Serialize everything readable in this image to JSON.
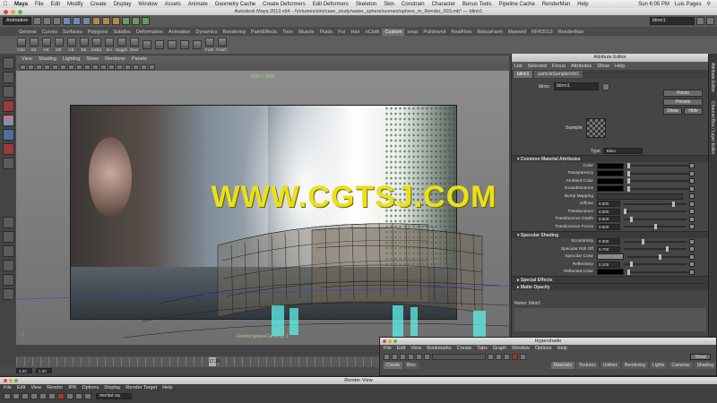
{
  "macmenu": {
    "app": "Maya",
    "items": [
      "File",
      "Edit",
      "Modify",
      "Create",
      "Display",
      "Window",
      "Assets",
      "Animate",
      "Geometry Cache",
      "Create Deformers",
      "Edit Deformers",
      "Skeleton",
      "Skin",
      "Constrain",
      "Character",
      "Bonus Tools",
      "Pipeline Cache",
      "RenderMan",
      "Help"
    ],
    "clock": "Sun 6:05 PM",
    "user": "Luis Pages"
  },
  "window": {
    "title": "Autodesk Maya 2013 x64 - /Volumes/sim/case_study/water_sphere/scenes/sphere_m_Render_003.mb* --- blinn1"
  },
  "statusline": {
    "mode": "Animation",
    "field": "blinn1"
  },
  "shelf": {
    "tabs": [
      "General",
      "Curves",
      "Surfaces",
      "Polygons",
      "Subdivs",
      "Deformation",
      "Animation",
      "Dynamics",
      "Rendering",
      "PaintEffects",
      "Toon",
      "Muscle",
      "Fluids",
      "Fur",
      "Hair",
      "nCloth",
      "Custom",
      "soup",
      "Pulldownit",
      "RealFlow",
      "RebusFarm",
      "Maxwell",
      "RFR2013",
      "RenderMan"
    ],
    "active_tab": "Custom",
    "icons": [
      "OutI",
      "SS",
      "HS",
      "DR",
      "CE",
      "EE",
      "bishd",
      "SH",
      "Hpgph",
      "Dext",
      "",
      "",
      "",
      "",
      "",
      "FLW",
      "FLWC"
    ]
  },
  "viewport": {
    "menu": [
      "View",
      "Shading",
      "Lighting",
      "Show",
      "Renderer",
      "Panels"
    ],
    "resolution": "1920 x 1080",
    "camera": "RenderSphereCamera1 1",
    "watermark": "WWW.CGTSJ.COM"
  },
  "timeslider": {
    "current_frame": "17.20",
    "start": "1.00",
    "end": "1.00"
  },
  "attribute_editor": {
    "title": "Attribute Editor",
    "menu": [
      "List",
      "Selected",
      "Focus",
      "Attributes",
      "Show",
      "Help"
    ],
    "tabs": [
      "blinn1",
      "particleSamplerInfo1"
    ],
    "node_label": "blinn:",
    "node_name": "blinn1",
    "focus_label": "Focus",
    "presets_label": "Presets",
    "show_label": "Show",
    "hide_label": "Hide",
    "sample_label": "Sample",
    "type_label": "Type",
    "type_value": "Blinn",
    "sections": {
      "common": "Common Material Attributes",
      "specular": "Specular Shading",
      "special": "Special Effects",
      "matte": "Matte Opacity"
    },
    "common_attrs": [
      {
        "label": "Color",
        "color": "#000000"
      },
      {
        "label": "Transparency",
        "color": "#000000"
      },
      {
        "label": "Ambient Color",
        "color": "#000000"
      },
      {
        "label": "Incandescence",
        "color": "#000000"
      }
    ],
    "bump_label": "Bump Mapping",
    "numeric_attrs": [
      {
        "label": "Diffuse",
        "value": "0.800",
        "fraction": 0.8
      },
      {
        "label": "Translucence",
        "value": "0.000",
        "fraction": 0.0
      },
      {
        "label": "Translucence Depth",
        "value": "0.500",
        "fraction": 0.1
      },
      {
        "label": "Translucence Focus",
        "value": "0.500",
        "fraction": 0.5
      }
    ],
    "specular_attrs": [
      {
        "label": "Eccentricity",
        "value": "0.300",
        "fraction": 0.3
      },
      {
        "label": "Specular Roll Off",
        "value": "0.700",
        "fraction": 0.7
      },
      {
        "label": "Specular Color",
        "color": "#8a8a8a"
      },
      {
        "label": "Reflectivity",
        "value": "0.100",
        "fraction": 0.1
      },
      {
        "label": "Reflected Color",
        "color": "#000000"
      }
    ],
    "notes_label": "Notes:",
    "notes_value": "blinn1"
  },
  "sidebar": {
    "labels": [
      "Attribute Editor",
      "Channel Box / Layer Editor"
    ]
  },
  "hypershade": {
    "title": "Hypershade",
    "menu": [
      "File",
      "Edit",
      "View",
      "Bookmarks",
      "Create",
      "Tabs",
      "Graph",
      "Window",
      "Options",
      "Help"
    ],
    "show_label": "Show",
    "left_tabs": [
      "Create",
      "Bins"
    ],
    "right_tabs": [
      "Materials",
      "Textures",
      "Utilities",
      "Rendering",
      "Lights",
      "Cameras",
      "Shading"
    ]
  },
  "renderview": {
    "title": "Render View",
    "menu": [
      "File",
      "Edit",
      "View",
      "Render",
      "IPR",
      "Options",
      "Display",
      "Render Target",
      "Help"
    ],
    "renderer": "mental ray"
  }
}
